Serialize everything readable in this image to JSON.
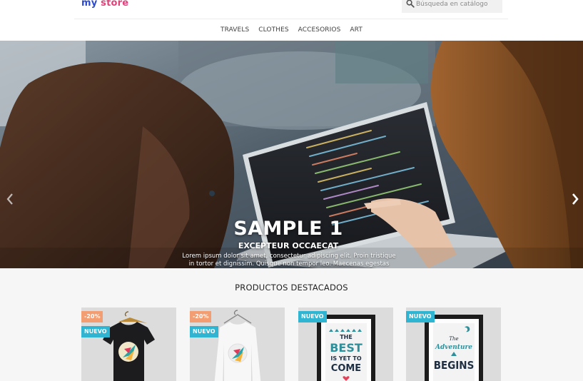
{
  "header": {
    "logo_part1": "my",
    "logo_part2": "store",
    "search_placeholder": "Búsqueda en catálogo"
  },
  "menu": [
    {
      "label": "TRAVELS"
    },
    {
      "label": "CLOTHES"
    },
    {
      "label": "ACCESORIOS"
    },
    {
      "label": "ART"
    }
  ],
  "hero": {
    "title": "SAMPLE 1",
    "subtitle": "EXCEPTEUR OCCAECAT",
    "description": "Lorem ipsum dolor sit amet, consectetur adipiscing elit. Proin tristique in tortor et dignissim. Quisque non tempor leo. Maecenas egestas sem elit",
    "prev_icon": "chevron-left-icon",
    "next_icon": "chevron-right-icon"
  },
  "featured": {
    "title": "PRODUCTOS DESTACADOS",
    "products": [
      {
        "discount": "-20%",
        "flag": "NUEVO",
        "image": "black-tshirt-hummingbird"
      },
      {
        "discount": "-20%",
        "flag": "NUEVO",
        "image": "white-sweater-hummingbird"
      },
      {
        "flag": "NUEVO",
        "image": "poster-the-best-is-yet-to-come",
        "poster_lines": [
          "THE",
          "BEST",
          "IS YET TO",
          "COME"
        ]
      },
      {
        "flag": "NUEVO",
        "image": "poster-the-adventure-begins",
        "poster_lines": [
          "The",
          "Adventure",
          "BEGINS"
        ]
      }
    ]
  },
  "colors": {
    "accent": "#2fb5d2",
    "discount": "#f39d72",
    "logo_blue": "#2b4bd6",
    "logo_pink": "#e2427a"
  }
}
